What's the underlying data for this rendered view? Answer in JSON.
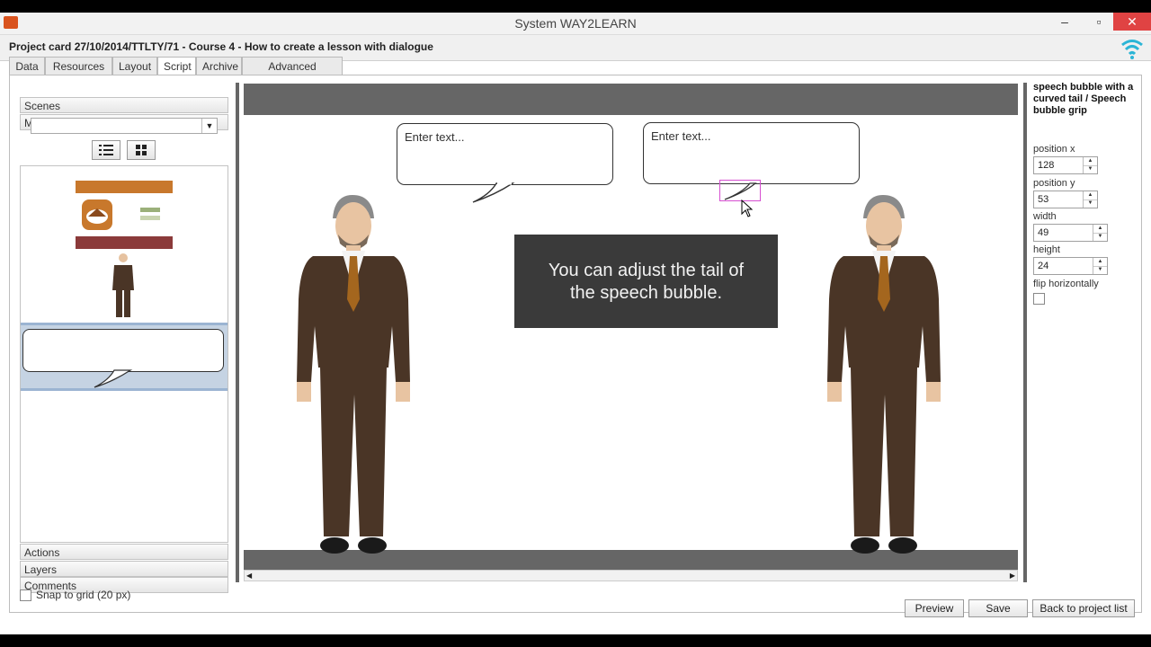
{
  "window": {
    "title": "System WAY2LEARN",
    "minimize": "–",
    "restore": "▫",
    "close": "✕"
  },
  "project": {
    "title": "Project card 27/10/2014/TTLTY/71 - Course 4 - How to create a lesson with dialogue"
  },
  "tabs": [
    "Data",
    "Resources",
    "Layout",
    "Script",
    "Archive",
    "Advanced settings"
  ],
  "active_tab": "Script",
  "left_panel": {
    "scenes": "Scenes",
    "my_resources": "My resources",
    "actions": "Actions",
    "layers": "Layers",
    "comments": "Comments",
    "snap_label": "Snap to grid (20 px)"
  },
  "stage": {
    "bubble1_text": "Enter text...",
    "bubble2_text": "Enter text...",
    "info_line1": "You can adjust the tail of",
    "info_line2": "the speech bubble."
  },
  "properties": {
    "title": "speech bubble with a curved tail / Speech bubble grip",
    "position_x_label": "position x",
    "position_x": "128",
    "position_y_label": "position y",
    "position_y": "53",
    "width_label": "width",
    "width": "49",
    "height_label": "height",
    "height": "24",
    "flip_label": "flip horizontally"
  },
  "buttons": {
    "preview": "Preview",
    "save": "Save",
    "back": "Back to project list"
  },
  "colors": {
    "accent_orange": "#c8782c",
    "resource_red": "#8b3a3a",
    "suit": "#4a3526",
    "close": "#e04343"
  }
}
